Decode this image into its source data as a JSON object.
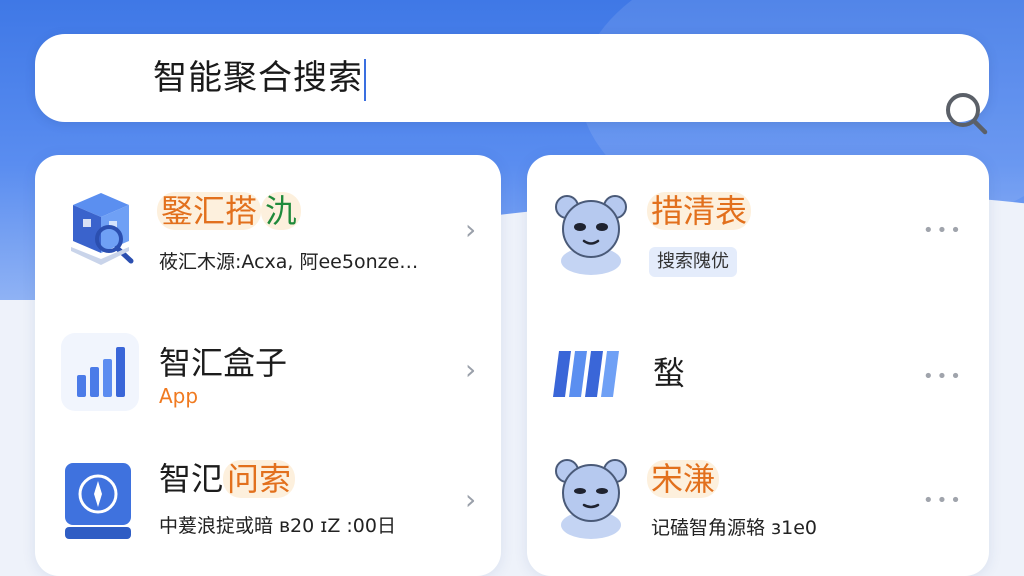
{
  "search": {
    "query": "智能聚合搜索",
    "icon": "search-icon"
  },
  "left_list": [
    {
      "icon": "toolbox-cube-icon",
      "title_a": "",
      "title_hl": "鋻汇搭",
      "title_b": "氿",
      "subtitle": "莜汇木源:Acxa, 阿ee5onze…",
      "chevron": "›"
    },
    {
      "icon": "bar-chart-app-icon",
      "title": "智汇盒子",
      "subtitle": "App",
      "chevron": "›"
    },
    {
      "icon": "compass-book-icon",
      "title_a": "智氾",
      "title_hl": "问索",
      "subtitle": "中萲浪掟或暗 ʙ20 ɪZ :00日",
      "chevron": "›"
    }
  ],
  "right_list": [
    {
      "icon": "bear-avatar-icon",
      "title_hl": "措清表",
      "tag": "搜索隗优",
      "more": "•••"
    },
    {
      "icon": "stripes-logo-icon",
      "title": "蝵",
      "more": "•••"
    },
    {
      "icon": "bear-avatar-icon",
      "title_hl": "宋溓",
      "subtitle": "记磕智角源辂 ɜ1e0",
      "more": "•••"
    }
  ],
  "colors": {
    "accent": "#3f78e6",
    "highlight_orange": "#e2701d",
    "highlight_green": "#1f8a3b"
  }
}
